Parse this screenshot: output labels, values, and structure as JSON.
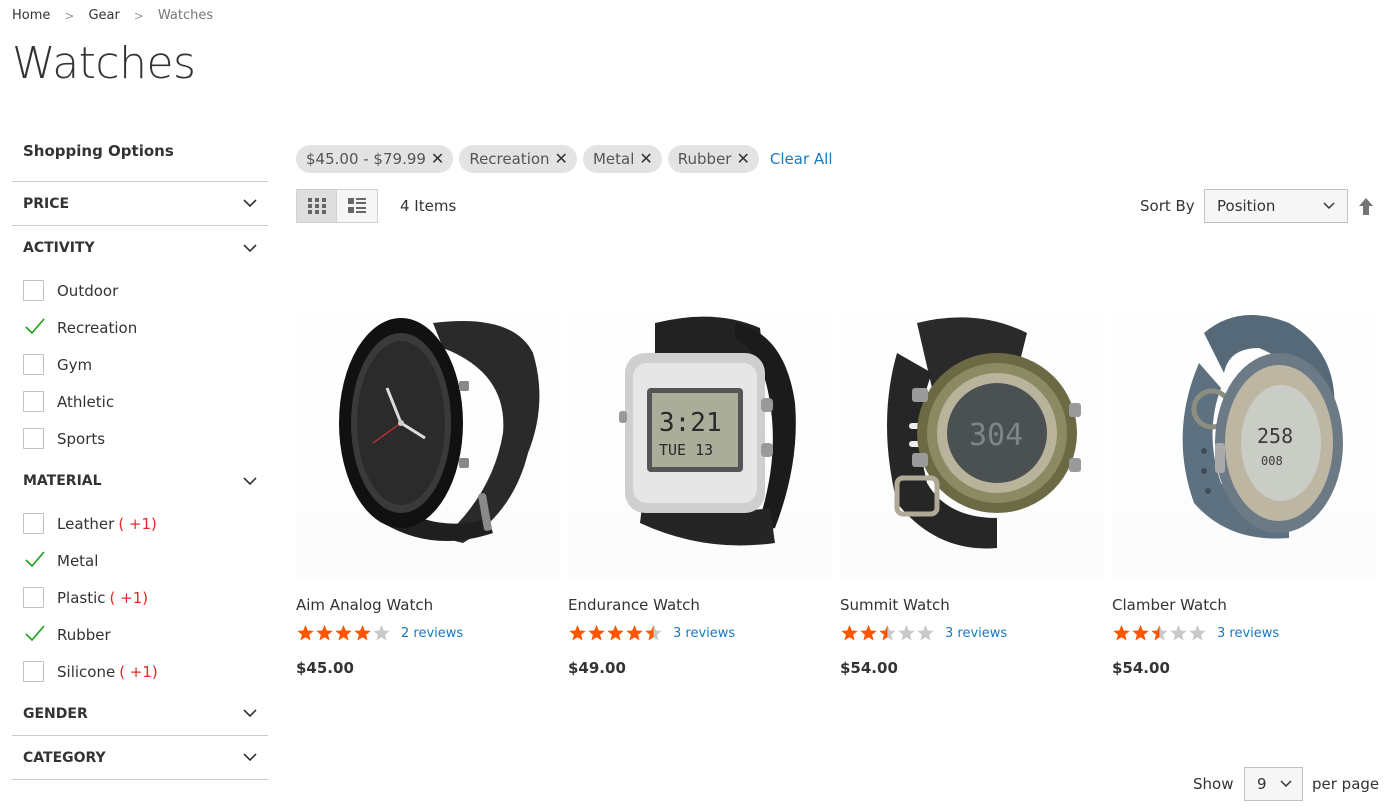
{
  "breadcrumb": {
    "items": [
      "Home",
      "Gear",
      "Watches"
    ]
  },
  "page": {
    "title": "Watches"
  },
  "sidebar": {
    "title": "Shopping Options",
    "price": {
      "label": "PRICE"
    },
    "activity": {
      "label": "ACTIVITY",
      "options": [
        {
          "label": "Outdoor",
          "checked": false
        },
        {
          "label": "Recreation",
          "checked": true
        },
        {
          "label": "Gym",
          "checked": false
        },
        {
          "label": "Athletic",
          "checked": false
        },
        {
          "label": "Sports",
          "checked": false
        }
      ]
    },
    "material": {
      "label": "MATERIAL",
      "options": [
        {
          "label": "Leather",
          "count": "( +1)",
          "checked": false
        },
        {
          "label": "Metal",
          "count": "",
          "checked": true
        },
        {
          "label": "Plastic",
          "count": "( +1)",
          "checked": false
        },
        {
          "label": "Rubber",
          "count": "",
          "checked": true
        },
        {
          "label": "Silicone",
          "count": "( +1)",
          "checked": false
        }
      ]
    },
    "gender": {
      "label": "GENDER"
    },
    "category": {
      "label": "CATEGORY"
    }
  },
  "active_filters": {
    "chips": [
      "$45.00 - $79.99",
      "Recreation",
      "Metal",
      "Rubber"
    ],
    "clear_all": "Clear All"
  },
  "toolbar": {
    "items_count": "4 Items",
    "sort_label": "Sort By",
    "sort_value": "Position"
  },
  "products": [
    {
      "name": "Aim Analog Watch",
      "rating": 4,
      "reviews": "2 reviews",
      "price": "$45.00"
    },
    {
      "name": "Endurance Watch",
      "rating": 4.5,
      "reviews": "3 reviews",
      "price": "$49.00"
    },
    {
      "name": "Summit Watch",
      "rating": 2.5,
      "reviews": "3 reviews",
      "price": "$54.00"
    },
    {
      "name": "Clamber Watch",
      "rating": 2.5,
      "reviews": "3 reviews",
      "price": "$54.00"
    }
  ],
  "limiter": {
    "show_label": "Show",
    "value": "9",
    "per_page": "per page"
  },
  "colors": {
    "star_on": "#ff5501",
    "star_off": "#c9c9c9",
    "link": "#1979c3",
    "check": "#1a9f1a",
    "count": "#e02b27"
  }
}
